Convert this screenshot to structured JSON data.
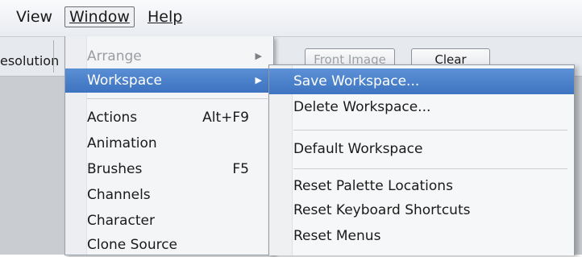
{
  "menubar": {
    "items": [
      {
        "label": "View"
      },
      {
        "label": "Window"
      },
      {
        "label": "Help"
      }
    ]
  },
  "options_bar": {
    "partial_label": "esolution",
    "front_image_label": "Front Image",
    "clear_label": "Clear"
  },
  "window_menu": {
    "items": [
      {
        "label": "Arrange",
        "disabled": true,
        "submenu": true
      },
      {
        "label": "Workspace",
        "highlighted": true,
        "submenu": true
      },
      {
        "label": "Actions",
        "shortcut": "Alt+F9"
      },
      {
        "label": "Animation"
      },
      {
        "label": "Brushes",
        "shortcut": "F5"
      },
      {
        "label": "Channels"
      },
      {
        "label": "Character"
      },
      {
        "label": "Clone Source"
      }
    ]
  },
  "workspace_submenu": {
    "items": [
      {
        "label": "Save Workspace...",
        "highlighted": true
      },
      {
        "label": "Delete Workspace..."
      },
      {
        "label": "Default Workspace"
      },
      {
        "label": "Reset Palette Locations"
      },
      {
        "label": "Reset Keyboard Shortcuts"
      },
      {
        "label": "Reset Menus"
      }
    ]
  },
  "colors": {
    "highlight": "#4a7fca",
    "menu_bg": "#f4f5f7",
    "workspace_bg": "#c9ccd0"
  }
}
